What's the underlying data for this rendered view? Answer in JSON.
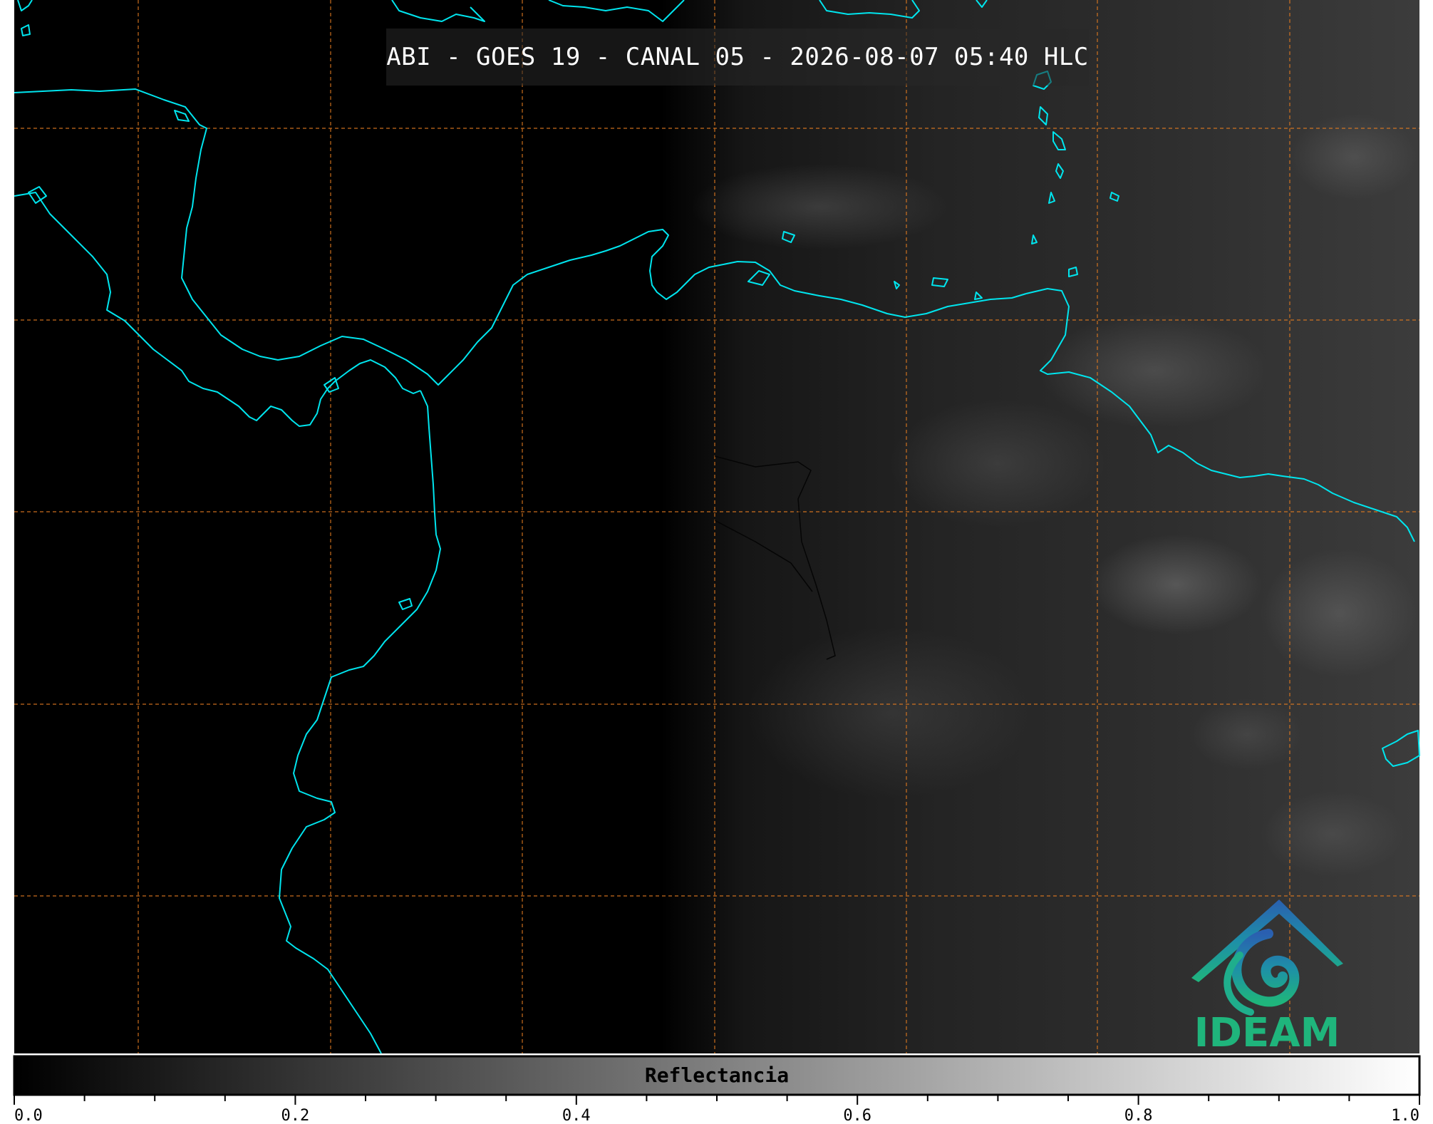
{
  "title": "ABI - GOES 19 - CANAL 05 - 2026-08-07 05:40 HLC",
  "colorbar": {
    "label": "Reflectancia",
    "ticks": [
      "0.0",
      "0.2",
      "0.4",
      "0.6",
      "0.8",
      "1.0"
    ],
    "range": [
      0.0,
      1.0
    ],
    "gradient": [
      "#000000",
      "#ffffff"
    ]
  },
  "logo": {
    "text": "IDEAM",
    "icon": "ideam-swirl-logo-icon"
  },
  "colors": {
    "coastline": "#00e5ee",
    "gridlines": "#e07a20",
    "background": "#000000"
  }
}
